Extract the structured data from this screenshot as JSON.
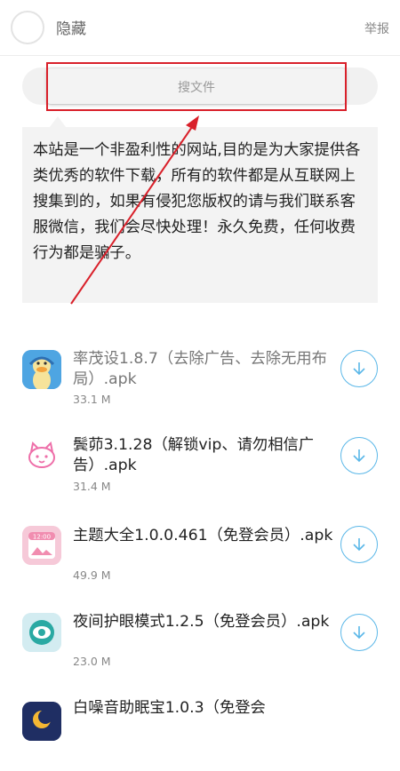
{
  "header": {
    "title": "隐藏",
    "report_label": "举报"
  },
  "search": {
    "placeholder": "搜文件"
  },
  "notice": {
    "text": "本站是一个非盈利性的网站,目的是为大家提供各类优秀的软件下载，所有的软件都是从互联网上搜集到的，如果有侵犯您版权的请与我们联系客服微信，我们会尽快处理！永久免费，任何收费行为都是骗子。"
  },
  "annotation": {
    "color": "#d9202a"
  },
  "accent_color": "#5ab7e8",
  "files": [
    {
      "name": "率茂设1.8.7（去除广告、去除无用布局）.apk",
      "size": "33.1 M",
      "icon": "duck-app-icon"
    },
    {
      "name": "鬓茆3.1.28（解锁vip、请勿相信广告）.apk",
      "size": "31.4 M",
      "icon": "cat-app-icon"
    },
    {
      "name": "主题大全1.0.0.461（免登会员）.apk",
      "size": "49.9 M",
      "icon": "theme-app-icon"
    },
    {
      "name": "夜间护眼模式1.2.5（免登会员）.apk",
      "size": "23.0 M",
      "icon": "eye-app-icon"
    },
    {
      "name": "白噪音助眠宝1.0.3（免登会",
      "size": "",
      "icon": "moon-app-icon"
    }
  ]
}
